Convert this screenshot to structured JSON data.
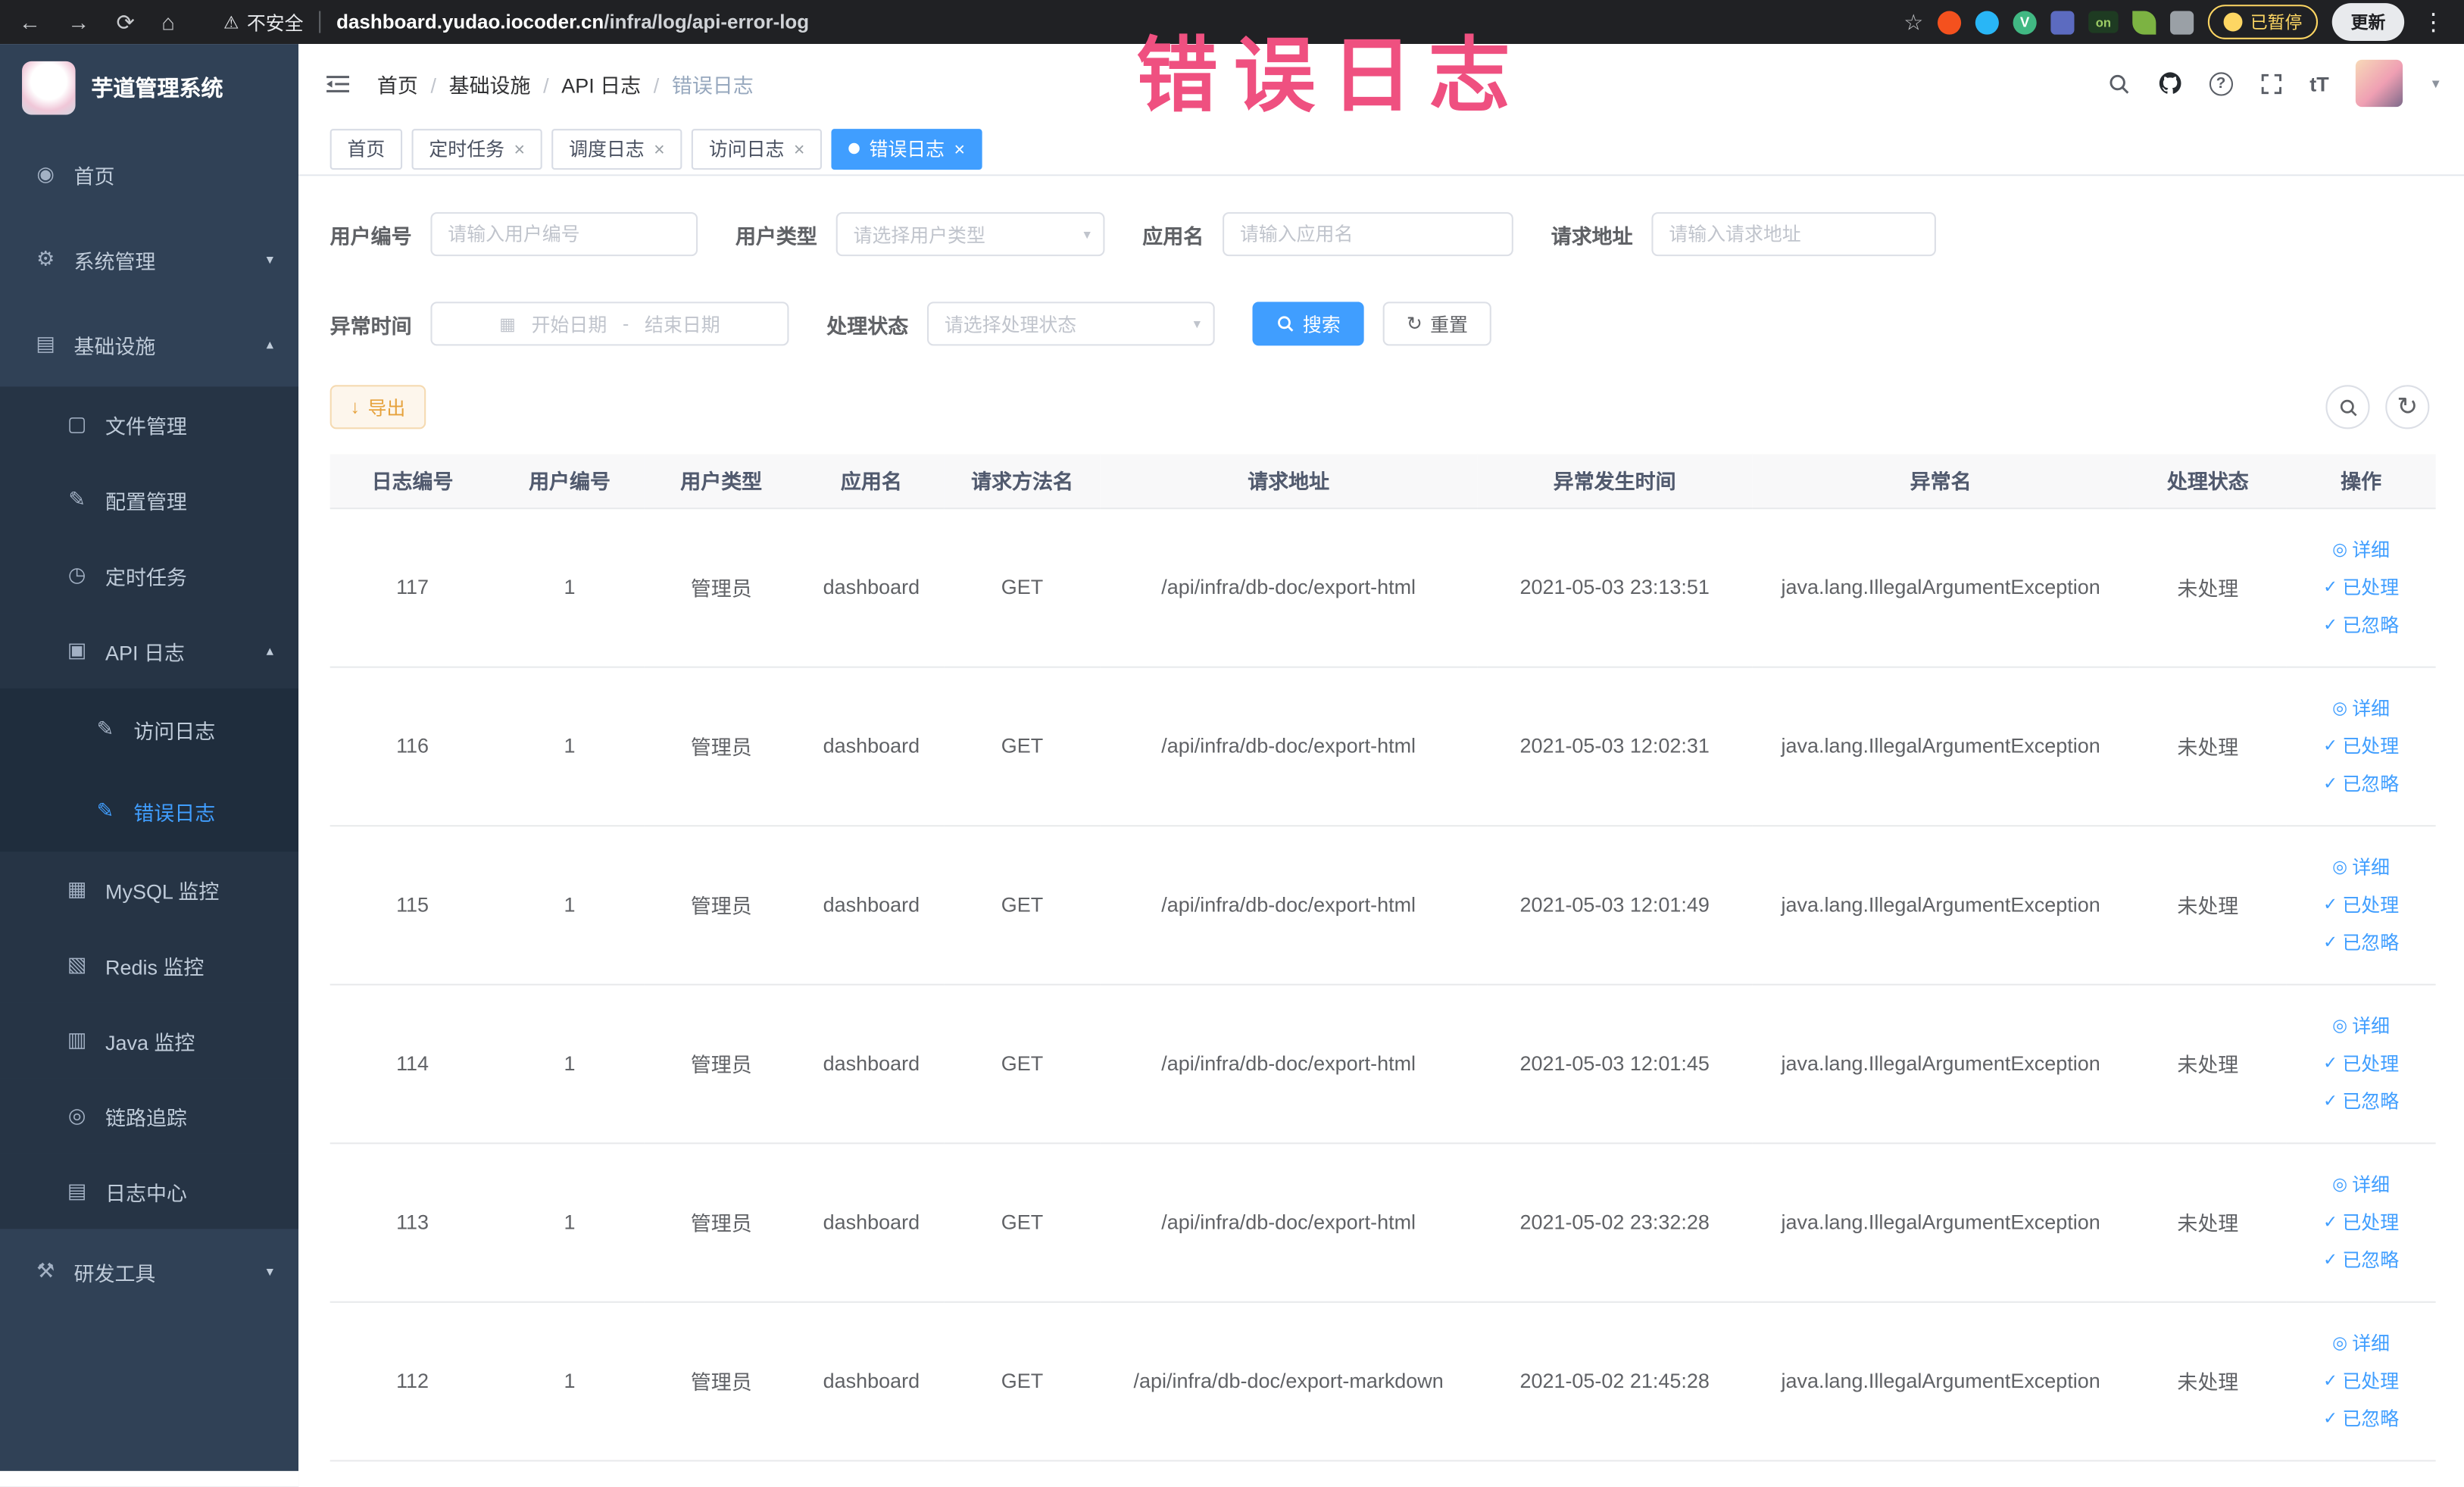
{
  "browser": {
    "security_label": "不安全",
    "url_domain": "dashboard.yudao.iocoder.cn",
    "url_path": "/infra/log/api-error-log",
    "paused_badge": "已暂停",
    "update_button": "更新",
    "ext_on_label": "on",
    "ext_vue_label": "V"
  },
  "annotation": "错误日志",
  "colors": {
    "accent": "#409EFF",
    "sidebar_bg": "#304156",
    "sidebar_sub_bg": "#263445",
    "sidebar_deep_bg": "#1f2d3d",
    "warning": "#e6a23c",
    "annotation": "#ef5080",
    "chrome_bg": "#202124"
  },
  "icons": {
    "back": "←",
    "forward": "→",
    "reload": "⟳",
    "home": "⌂",
    "warning": "⚠",
    "star": "☆",
    "kebab": "⋮",
    "chevron_down": "▾",
    "chevron_up": "▴",
    "close": "×",
    "help": "?",
    "font_size": "tT",
    "caret": "▼",
    "calendar": "▦",
    "refresh": "↻",
    "download": "↓",
    "detail": "◎",
    "check": "✓"
  },
  "sidebar": {
    "logo_title": "芋道管理系统",
    "items": {
      "home": {
        "label": "首页",
        "icon": "◉"
      },
      "system": {
        "label": "系统管理",
        "icon": "⚙"
      },
      "infra": {
        "label": "基础设施",
        "icon": "▤"
      },
      "file": {
        "label": "文件管理",
        "icon": "▢"
      },
      "config": {
        "label": "配置管理",
        "icon": "✎"
      },
      "job": {
        "label": "定时任务",
        "icon": "◷"
      },
      "api_log": {
        "label": "API 日志",
        "icon": "▣"
      },
      "access_log": {
        "label": "访问日志",
        "icon": "✎"
      },
      "error_log": {
        "label": "错误日志",
        "icon": "✎"
      },
      "mysql": {
        "label": "MySQL 监控",
        "icon": "▦"
      },
      "redis": {
        "label": "Redis 监控",
        "icon": "▧"
      },
      "java": {
        "label": "Java 监控",
        "icon": "▥"
      },
      "trace": {
        "label": "链路追踪",
        "icon": "◎"
      },
      "log_center": {
        "label": "日志中心",
        "icon": "▤"
      },
      "devtools": {
        "label": "研发工具",
        "icon": "⚒"
      }
    }
  },
  "header": {
    "breadcrumb": [
      "首页",
      "基础设施",
      "API 日志",
      "错误日志"
    ]
  },
  "tabs": [
    {
      "label": "首页"
    },
    {
      "label": "定时任务"
    },
    {
      "label": "调度日志"
    },
    {
      "label": "访问日志"
    },
    {
      "label": "错误日志"
    }
  ],
  "filters": {
    "user_id": {
      "label": "用户编号",
      "placeholder": "请输入用户编号"
    },
    "user_type": {
      "label": "用户类型",
      "placeholder": "请选择用户类型"
    },
    "app_name": {
      "label": "应用名",
      "placeholder": "请输入应用名"
    },
    "request_url": {
      "label": "请求地址",
      "placeholder": "请输入请求地址"
    },
    "exception_time": {
      "label": "异常时间",
      "start_placeholder": "开始日期",
      "separator": "-",
      "end_placeholder": "结束日期"
    },
    "process_status": {
      "label": "处理状态",
      "placeholder": "请选择处理状态"
    },
    "search_button": "搜索",
    "reset_button": "重置"
  },
  "toolbar": {
    "export_button": "导出"
  },
  "table": {
    "columns": [
      "日志编号",
      "用户编号",
      "用户类型",
      "应用名",
      "请求方法名",
      "请求地址",
      "异常发生时间",
      "异常名",
      "处理状态",
      "操作"
    ],
    "actions": [
      "详细",
      "已处理",
      "已忽略"
    ],
    "rows": [
      {
        "id": "117",
        "user_id": "1",
        "user_type": "管理员",
        "app": "dashboard",
        "method": "GET",
        "url": "/api/infra/db-doc/export-html",
        "time": "2021-05-03 23:13:51",
        "exception": "java.lang.IllegalArgumentException",
        "status": "未处理"
      },
      {
        "id": "116",
        "user_id": "1",
        "user_type": "管理员",
        "app": "dashboard",
        "method": "GET",
        "url": "/api/infra/db-doc/export-html",
        "time": "2021-05-03 12:02:31",
        "exception": "java.lang.IllegalArgumentException",
        "status": "未处理"
      },
      {
        "id": "115",
        "user_id": "1",
        "user_type": "管理员",
        "app": "dashboard",
        "method": "GET",
        "url": "/api/infra/db-doc/export-html",
        "time": "2021-05-03 12:01:49",
        "exception": "java.lang.IllegalArgumentException",
        "status": "未处理"
      },
      {
        "id": "114",
        "user_id": "1",
        "user_type": "管理员",
        "app": "dashboard",
        "method": "GET",
        "url": "/api/infra/db-doc/export-html",
        "time": "2021-05-03 12:01:45",
        "exception": "java.lang.IllegalArgumentException",
        "status": "未处理"
      },
      {
        "id": "113",
        "user_id": "1",
        "user_type": "管理员",
        "app": "dashboard",
        "method": "GET",
        "url": "/api/infra/db-doc/export-html",
        "time": "2021-05-02 23:32:28",
        "exception": "java.lang.IllegalArgumentException",
        "status": "未处理"
      },
      {
        "id": "112",
        "user_id": "1",
        "user_type": "管理员",
        "app": "dashboard",
        "method": "GET",
        "url": "/api/infra/db-doc/export-markdown",
        "time": "2021-05-02 21:45:28",
        "exception": "java.lang.IllegalArgumentException",
        "status": "未处理"
      }
    ]
  }
}
